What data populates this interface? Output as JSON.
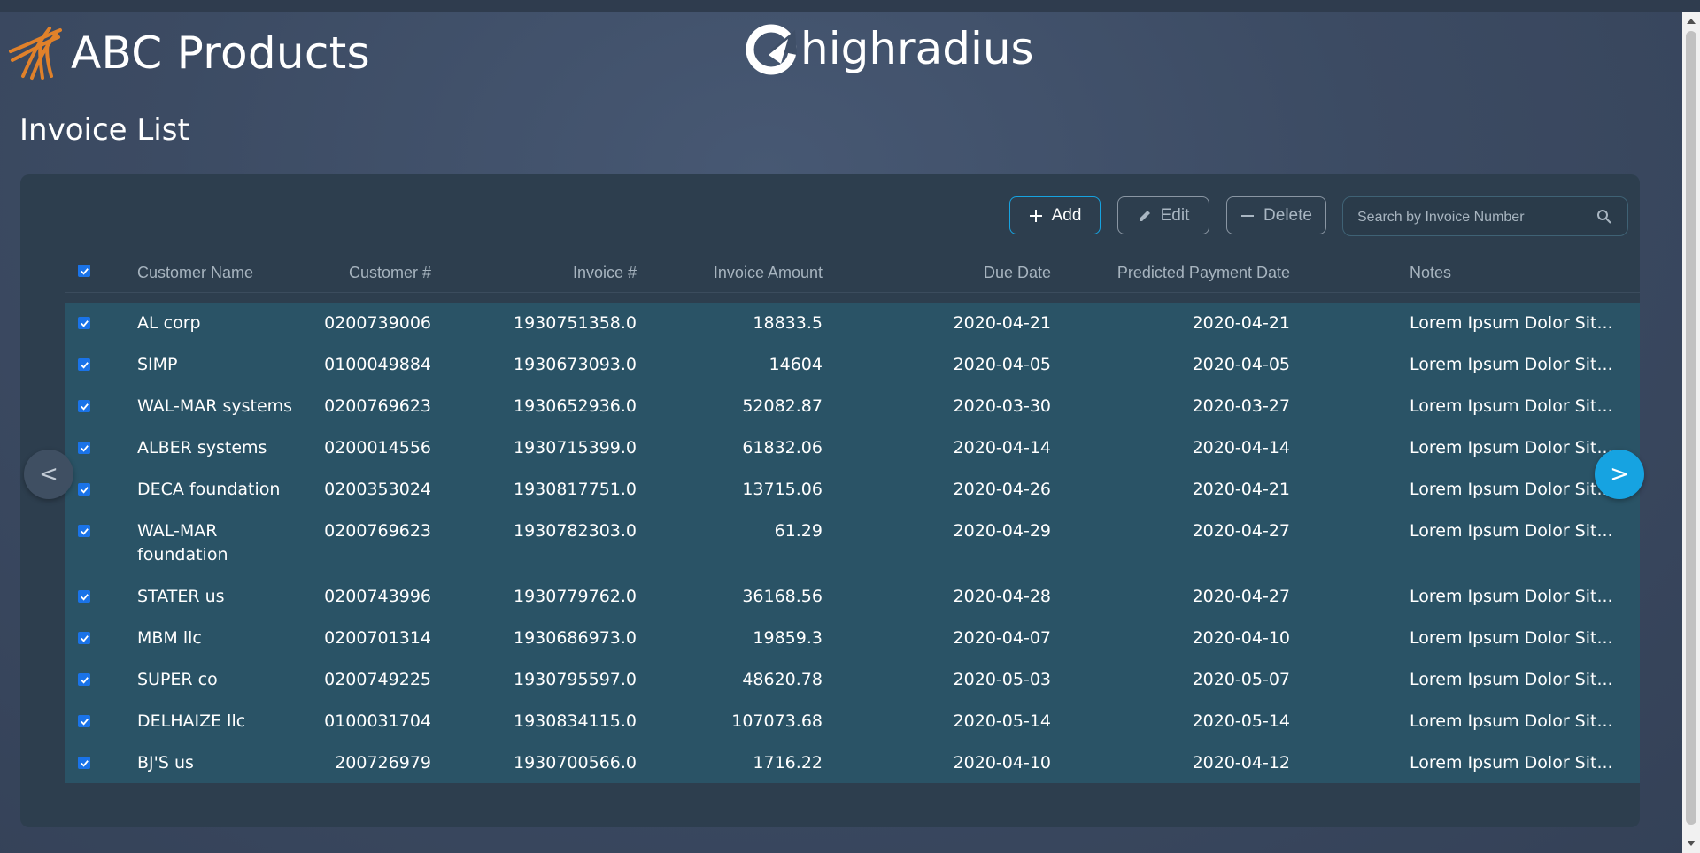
{
  "brand": {
    "name": "ABC Products",
    "partner": "highradius"
  },
  "page": {
    "title": "Invoice List"
  },
  "toolbar": {
    "add_label": "Add",
    "edit_label": "Edit",
    "delete_label": "Delete",
    "search_placeholder": "Search by Invoice Number"
  },
  "table": {
    "columns": [
      "Customer Name",
      "Customer #",
      "Invoice #",
      "Invoice Amount",
      "Due Date",
      "Predicted Payment Date",
      "Notes"
    ],
    "header_checked": true,
    "rows": [
      {
        "customer_name": "AL corp",
        "customer_no": "0200739006",
        "invoice_no": "1930751358.0",
        "amount": "18833.5",
        "due_date": "2020-04-21",
        "predicted_date": "2020-04-21",
        "notes": "Lorem Ipsum Dolor Sit...",
        "checked": true
      },
      {
        "customer_name": "SIMP",
        "customer_no": "0100049884",
        "invoice_no": "1930673093.0",
        "amount": "14604",
        "due_date": "2020-04-05",
        "predicted_date": "2020-04-05",
        "notes": "Lorem Ipsum Dolor Sit...",
        "checked": true
      },
      {
        "customer_name": "WAL-MAR systems",
        "customer_no": "0200769623",
        "invoice_no": "1930652936.0",
        "amount": "52082.87",
        "due_date": "2020-03-30",
        "predicted_date": "2020-03-27",
        "notes": "Lorem Ipsum Dolor Sit...",
        "checked": true
      },
      {
        "customer_name": "ALBER systems",
        "customer_no": "0200014556",
        "invoice_no": "1930715399.0",
        "amount": "61832.06",
        "due_date": "2020-04-14",
        "predicted_date": "2020-04-14",
        "notes": "Lorem Ipsum Dolor Sit...",
        "checked": true
      },
      {
        "customer_name": "DECA foundation",
        "customer_no": "0200353024",
        "invoice_no": "1930817751.0",
        "amount": "13715.06",
        "due_date": "2020-04-26",
        "predicted_date": "2020-04-21",
        "notes": "Lorem Ipsum Dolor Sit...",
        "checked": true
      },
      {
        "customer_name": "WAL-MAR foundation",
        "customer_name_line1": "WAL-MAR",
        "customer_name_line2": "foundation",
        "customer_no": "0200769623",
        "invoice_no": "1930782303.0",
        "amount": "61.29",
        "due_date": "2020-04-29",
        "predicted_date": "2020-04-27",
        "notes": "Lorem Ipsum Dolor Sit...",
        "checked": true
      },
      {
        "customer_name": "STATER us",
        "customer_no": "0200743996",
        "invoice_no": "1930779762.0",
        "amount": "36168.56",
        "due_date": "2020-04-28",
        "predicted_date": "2020-04-27",
        "notes": "Lorem Ipsum Dolor Sit...",
        "checked": true
      },
      {
        "customer_name": "MBM llc",
        "customer_no": "0200701314",
        "invoice_no": "1930686973.0",
        "amount": "19859.3",
        "due_date": "2020-04-07",
        "predicted_date": "2020-04-10",
        "notes": "Lorem Ipsum Dolor Sit...",
        "checked": true
      },
      {
        "customer_name": "SUPER co",
        "customer_no": "0200749225",
        "invoice_no": "1930795597.0",
        "amount": "48620.78",
        "due_date": "2020-05-03",
        "predicted_date": "2020-05-07",
        "notes": "Lorem Ipsum Dolor Sit...",
        "checked": true
      },
      {
        "customer_name": "DELHAIZE llc",
        "customer_no": "0100031704",
        "invoice_no": "1930834115.0",
        "amount": "107073.68",
        "due_date": "2020-05-14",
        "predicted_date": "2020-05-14",
        "notes": "Lorem Ipsum Dolor Sit...",
        "checked": true
      },
      {
        "customer_name": "BJ'S us",
        "customer_no": "200726979",
        "invoice_no": "1930700566.0",
        "amount": "1716.22",
        "due_date": "2020-04-10",
        "predicted_date": "2020-04-12",
        "notes": "Lorem Ipsum Dolor Sit...",
        "checked": true
      }
    ]
  },
  "nav": {
    "prev_label": "<",
    "next_label": ">"
  },
  "icons": {
    "brand": "abc-products-logo-icon",
    "partner": "highradius-logo-icon",
    "add": "plus-icon",
    "edit": "pencil-icon",
    "delete": "minus-icon",
    "search": "search-icon",
    "checkbox": "checkbox-checked-icon"
  },
  "colors": {
    "accent": "#16a3e1",
    "brand_orange": "#e0812a",
    "row_bg": "#2a5366",
    "panel_bg": "#2d3e4e",
    "checkbox": "#1a73e8"
  }
}
